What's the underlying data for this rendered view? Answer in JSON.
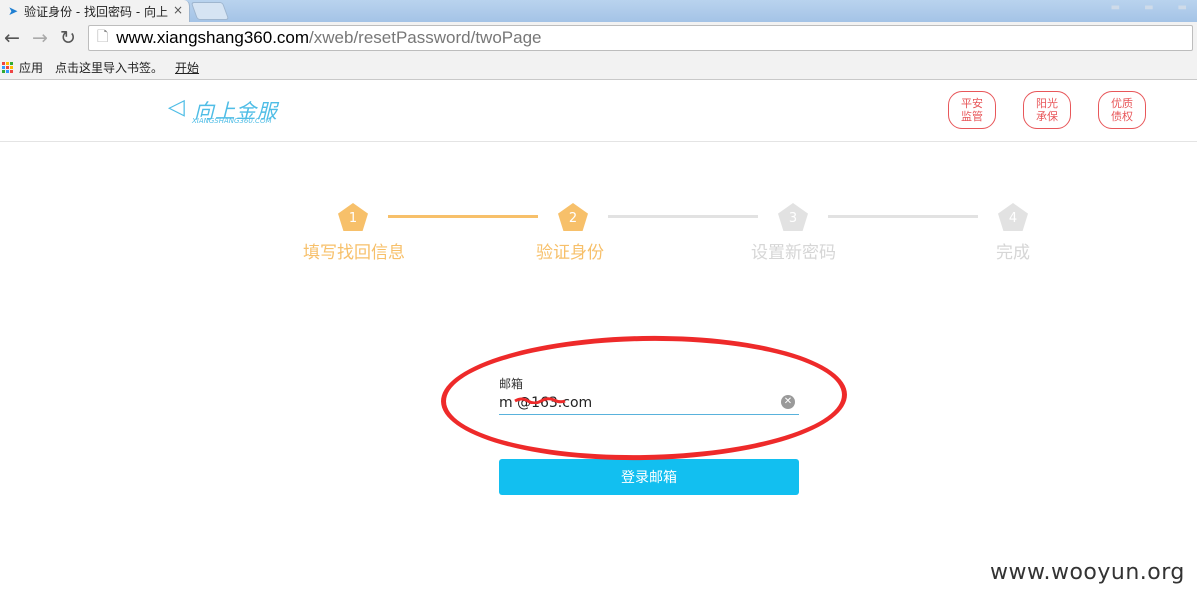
{
  "browser": {
    "tab_title": "验证身份 - 找回密码 - 向上",
    "tab_close": "×",
    "url_host": "www.xiangshang360.com",
    "url_path": "/xweb/resetPassword/twoPage",
    "bookmarks": [
      "应用",
      "点击这里导入书签。",
      "开始"
    ]
  },
  "site": {
    "logo_text": "向上金服",
    "logo_sub": "XIANGSHANG360.COM",
    "badges": [
      {
        "line1": "平安",
        "line2": "监管"
      },
      {
        "line1": "阳光",
        "line2": "承保"
      },
      {
        "line1": "优质",
        "line2": "债权"
      }
    ]
  },
  "steps": [
    {
      "num": "1",
      "label": "填写找回信息",
      "state": "done"
    },
    {
      "num": "2",
      "label": "验证身份",
      "state": "active"
    },
    {
      "num": "3",
      "label": "设置新密码",
      "state": "pending"
    },
    {
      "num": "4",
      "label": "完成",
      "state": "pending"
    }
  ],
  "form": {
    "email_label": "邮箱",
    "email_value": "m          @163.com",
    "submit_label": "登录邮箱"
  },
  "watermark": "www.wooyun.org",
  "colors": {
    "step_active": "#f7c06a",
    "step_pending": "#e2e2e2",
    "button": "#12bff0",
    "badge": "#e8575a",
    "annotation": "#ee2a2a"
  }
}
